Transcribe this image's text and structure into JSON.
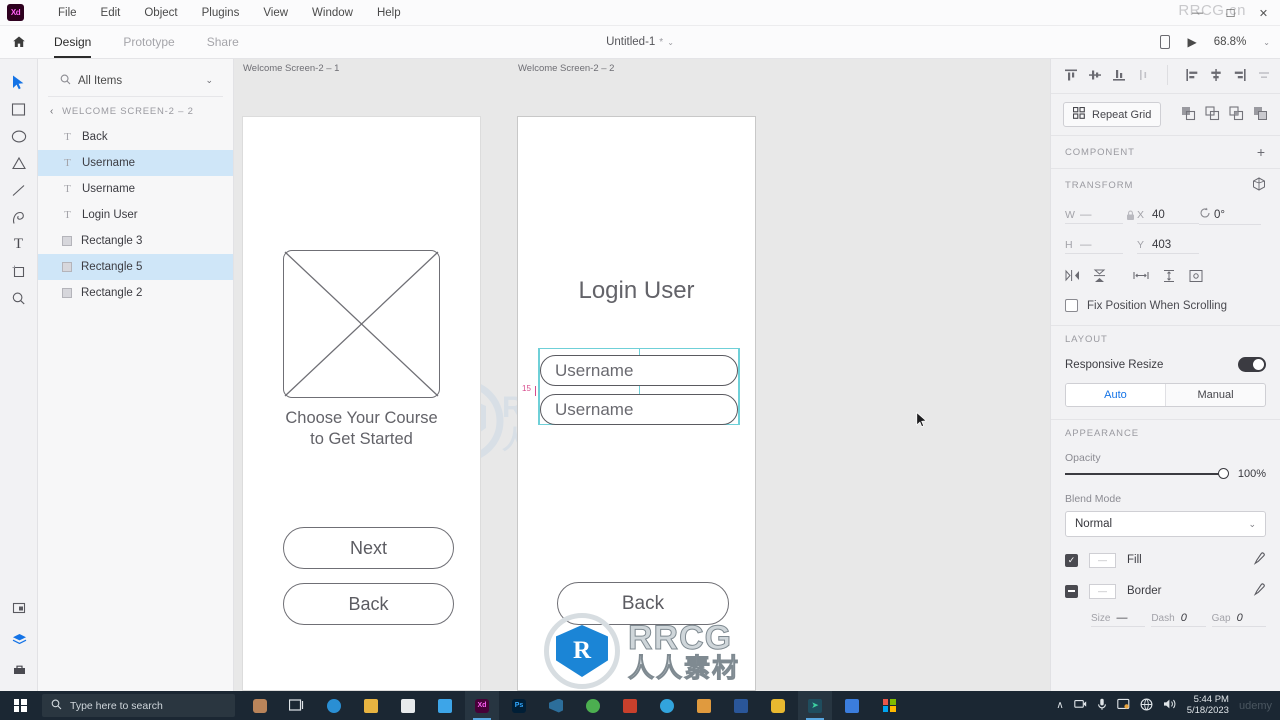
{
  "app": {
    "logo": "xd-logo",
    "window_controls": [
      "minimize",
      "maximize",
      "close"
    ],
    "watermark_title": "RRCG.cn"
  },
  "menubar": {
    "items": [
      {
        "label": "File"
      },
      {
        "label": "Edit"
      },
      {
        "label": "Object"
      },
      {
        "label": "Plugins"
      },
      {
        "label": "View"
      },
      {
        "label": "Window"
      },
      {
        "label": "Help"
      }
    ]
  },
  "modebar": {
    "home_icon": "home-icon",
    "modes": [
      {
        "label": "Design",
        "active": true
      },
      {
        "label": "Prototype",
        "active": false
      },
      {
        "label": "Share",
        "active": false
      }
    ],
    "document": {
      "title": "Untitled-1",
      "modified_marker": "*",
      "chevron": "⌄"
    },
    "right": {
      "device_preview_icon": "phone-icon",
      "play_icon": "play-icon",
      "zoom_level": "68.8%",
      "zoom_chevron": "⌄"
    }
  },
  "toolrail": {
    "tools": [
      {
        "name": "select-tool",
        "active": true
      },
      {
        "name": "rectangle-tool",
        "active": false
      },
      {
        "name": "ellipse-tool",
        "active": false
      },
      {
        "name": "polygon-tool",
        "active": false
      },
      {
        "name": "line-tool",
        "active": false
      },
      {
        "name": "pen-tool",
        "active": false
      },
      {
        "name": "text-tool",
        "active": false
      },
      {
        "name": "artboard-tool",
        "active": false
      },
      {
        "name": "zoom-tool",
        "active": false
      }
    ],
    "bottom_tools": [
      {
        "name": "components-panel-icon",
        "active": false
      },
      {
        "name": "layers-panel-icon",
        "active": true
      },
      {
        "name": "plugins-panel-icon",
        "active": false
      }
    ]
  },
  "layers_panel": {
    "search": {
      "icon": "search-icon",
      "value": "All Items",
      "placeholder": "All Items",
      "chevron": "⌄"
    },
    "group": {
      "back_chevron": "‹",
      "name": "WELCOME SCREEN-2 – 2"
    },
    "items": [
      {
        "label": "Back",
        "type": "text",
        "selected": false
      },
      {
        "label": "Username",
        "type": "text",
        "selected": true
      },
      {
        "label": "Username",
        "type": "text",
        "selected": false
      },
      {
        "label": "Login User",
        "type": "text",
        "selected": false
      },
      {
        "label": "Rectangle 3",
        "type": "shape",
        "selected": false
      },
      {
        "label": "Rectangle 5",
        "type": "shape",
        "selected": true
      },
      {
        "label": "Rectangle 2",
        "type": "shape",
        "selected": false
      }
    ]
  },
  "canvas": {
    "background": "#e8e8e8",
    "artboards": [
      {
        "label": "Welcome Screen-2 – 1",
        "placeholder_image": "image-placeholder-x",
        "heading_line1": "Choose Your Course",
        "heading_line2": "to Get Started",
        "buttons": [
          {
            "label": "Next"
          },
          {
            "label": "Back"
          }
        ]
      },
      {
        "label": "Welcome Screen-2 – 2",
        "title": "Login User",
        "fields": [
          {
            "value": "Username",
            "placeholder": "Username"
          },
          {
            "value": "Username",
            "placeholder": "Username"
          }
        ],
        "buttons": [
          {
            "label": "Back"
          }
        ],
        "selection": {
          "guide_color": "#6fd0d8",
          "spacing_label": "15",
          "spacing_label_color": "#d84a8c"
        }
      }
    ],
    "watermark": {
      "brand": "RRCG",
      "subtitle": "人人素材",
      "logo_letter": "R"
    }
  },
  "properties": {
    "align_icons_group1": [
      "align-top-icon",
      "align-middle-icon",
      "align-bottom-icon",
      "distribute-vertical-icon"
    ],
    "align_icons_group2": [
      "align-left-icon",
      "align-center-icon",
      "align-right-icon",
      "distribute-horizontal-icon"
    ],
    "repeat_grid": {
      "label": "Repeat Grid",
      "icon": "repeat-grid-icon",
      "boolean_ops": [
        "boolean-add-icon",
        "boolean-subtract-icon",
        "boolean-intersect-icon",
        "boolean-exclude-icon"
      ]
    },
    "component": {
      "title": "COMPONENT",
      "add_icon": "+"
    },
    "transform": {
      "title": "TRANSFORM",
      "three_d_icon": "3d-transform-icon",
      "w_label": "W",
      "w_value": "—",
      "h_label": "H",
      "h_value": "—",
      "lock_icon": "lock-icon",
      "x_label": "X",
      "x_value": "40",
      "y_label": "Y",
      "y_value": "403",
      "rotation_icon": "rotate-icon",
      "rotation_value": "0°",
      "tool_icons": [
        "flip-horizontal-icon",
        "flip-vertical-icon",
        "rounded-corner-all-icon",
        "corner-radius-icon",
        "path-options-icon"
      ],
      "fix_position": {
        "label": "Fix Position When Scrolling",
        "checked": false
      }
    },
    "layout": {
      "title": "LAYOUT",
      "responsive_resize": {
        "label": "Responsive Resize",
        "enabled": true
      },
      "modes": [
        {
          "label": "Auto",
          "active": true
        },
        {
          "label": "Manual",
          "active": false
        }
      ]
    },
    "appearance": {
      "title": "APPEARANCE",
      "opacity": {
        "label": "Opacity",
        "value": "100%",
        "percent": 100
      },
      "blend_mode": {
        "label": "Blend Mode",
        "value": "Normal",
        "chevron": "⌄"
      },
      "fill": {
        "label": "Fill",
        "checked": true,
        "swatch": "—",
        "eyedropper_icon": "eyedropper-icon"
      },
      "border": {
        "label": "Border",
        "partial": true,
        "swatch": "—",
        "eyedropper_icon": "eyedropper-icon",
        "size_label": "Size",
        "size_value": "—",
        "dash_label": "Dash",
        "dash_value": "0",
        "gap_label": "Gap",
        "gap_value": "0"
      }
    }
  },
  "taskbar": {
    "start_icon": "windows-start-icon",
    "search": {
      "icon": "search-icon",
      "placeholder": "Type here to search"
    },
    "apps": [
      {
        "name": "cortana-icon",
        "color": "#b9845a",
        "active": false
      },
      {
        "name": "task-view-icon",
        "color": "#dfe4e8",
        "active": false
      },
      {
        "name": "edge-icon",
        "color": "#2a8fd4",
        "active": false
      },
      {
        "name": "file-explorer-icon",
        "color": "#e8b441",
        "active": false
      },
      {
        "name": "store-icon",
        "color": "#e7eaec",
        "active": false
      },
      {
        "name": "mail-icon",
        "color": "#3da5e8",
        "active": false
      },
      {
        "name": "adobe-xd-icon",
        "color": "#470137",
        "active": true
      },
      {
        "name": "photoshop-icon",
        "color": "#001e36",
        "active": false
      },
      {
        "name": "vscode-icon",
        "color": "#2c6e9b",
        "active": false
      },
      {
        "name": "chrome-icon",
        "color": "#4caf50",
        "active": false
      },
      {
        "name": "powerpoint-icon",
        "color": "#c8402c",
        "active": false
      },
      {
        "name": "telegram-icon",
        "color": "#32a4dd",
        "active": false
      },
      {
        "name": "package-icon",
        "color": "#e09a3e",
        "active": false
      },
      {
        "name": "word-icon",
        "color": "#2a5699",
        "active": false
      },
      {
        "name": "lastpass-icon",
        "color": "#e8b830",
        "active": false
      },
      {
        "name": "filmora-icon",
        "color": "#3ccfa0",
        "active": true
      },
      {
        "name": "google-icon",
        "color": "#3b7ddd",
        "active": false
      },
      {
        "name": "microsoft-icon",
        "color": "#e8564a",
        "active": false
      }
    ],
    "tray": {
      "chevron": "∧",
      "icons": [
        "camera-icon",
        "microphone-icon",
        "screenshot-icon",
        "network-icon",
        "volume-icon"
      ],
      "time": "5:44 PM",
      "date": "5/18/2023",
      "watermark": "udemy"
    }
  }
}
